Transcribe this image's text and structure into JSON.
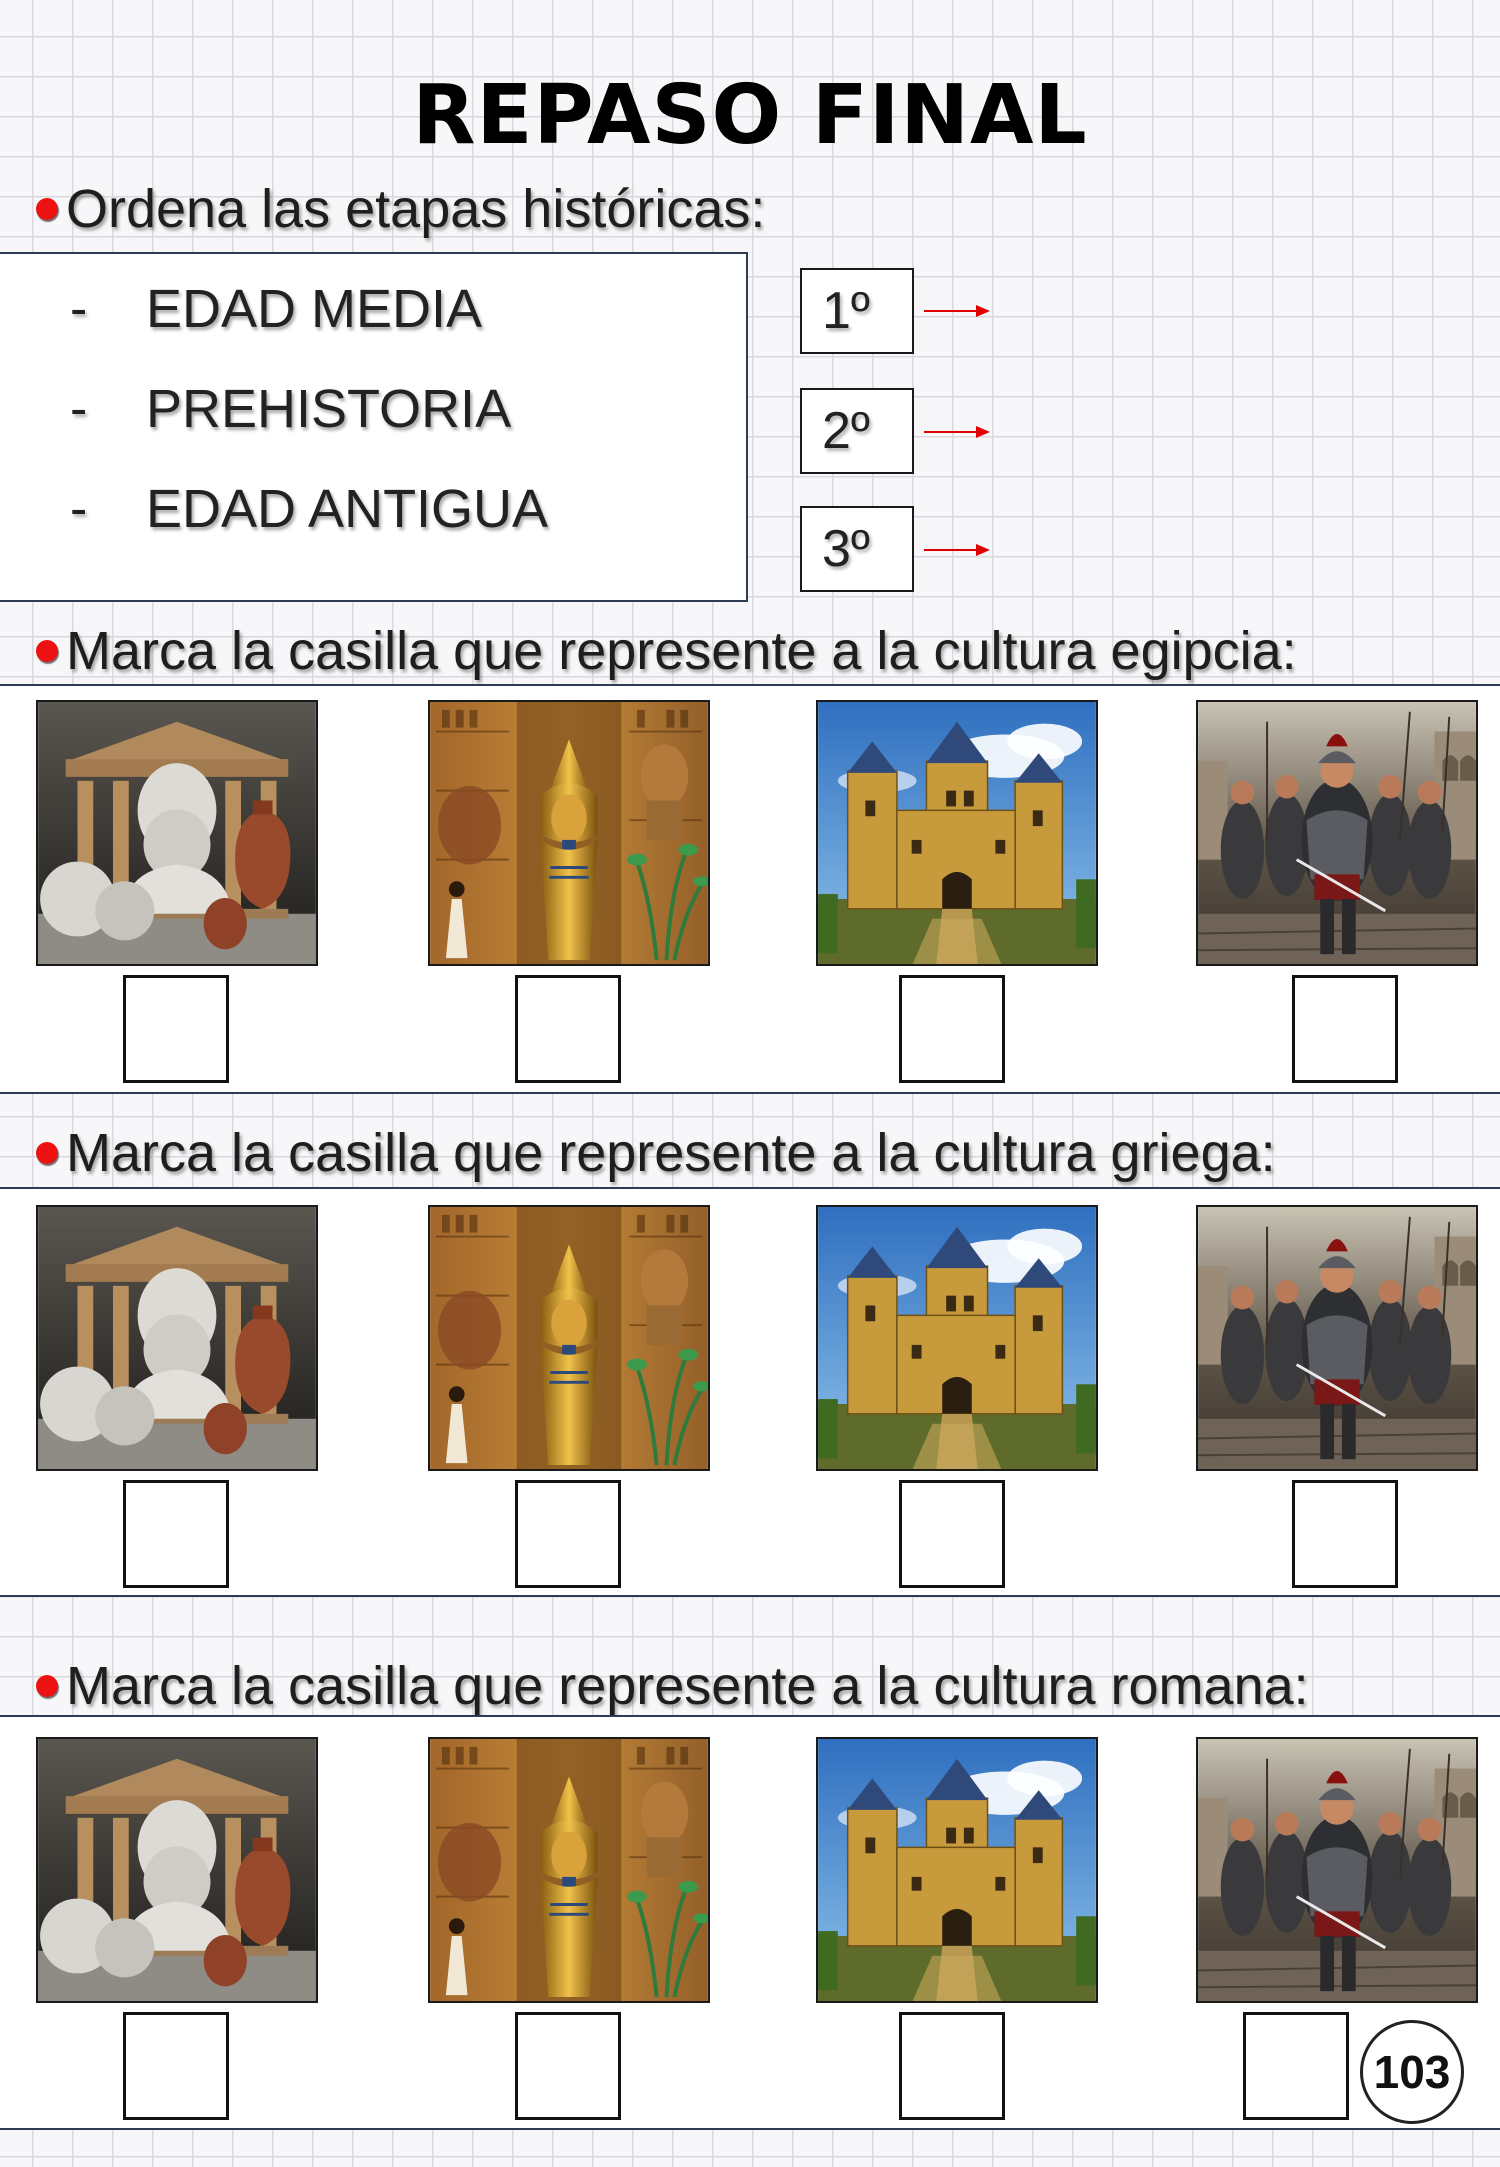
{
  "title": "REPASO FINAL",
  "section_order": {
    "instruction": "Ordena las etapas históricas:",
    "stages": [
      {
        "dash": "-",
        "label": "EDAD MEDIA"
      },
      {
        "dash": "-",
        "label": "PREHISTORIA"
      },
      {
        "dash": "-",
        "label": "EDAD ANTIGUA"
      }
    ],
    "ordinals": [
      "1º",
      "2º",
      "3º"
    ]
  },
  "questions": [
    {
      "instruction": "Marca la casilla que represente a la cultura egipcia:"
    },
    {
      "instruction": "Marca la casilla que represente a la cultura griega:"
    },
    {
      "instruction": "Marca la casilla que represente a la cultura romana:"
    }
  ],
  "images": [
    {
      "icon": "greek-temple-bust-image"
    },
    {
      "icon": "egyptian-pharaoh-sarcophagus-image"
    },
    {
      "icon": "medieval-castle-image"
    },
    {
      "icon": "roman-legionaries-image"
    }
  ],
  "page_number": "103",
  "colors": {
    "bullet": "#e11111",
    "border": "#2d3b53",
    "arrow": "#e00000"
  }
}
